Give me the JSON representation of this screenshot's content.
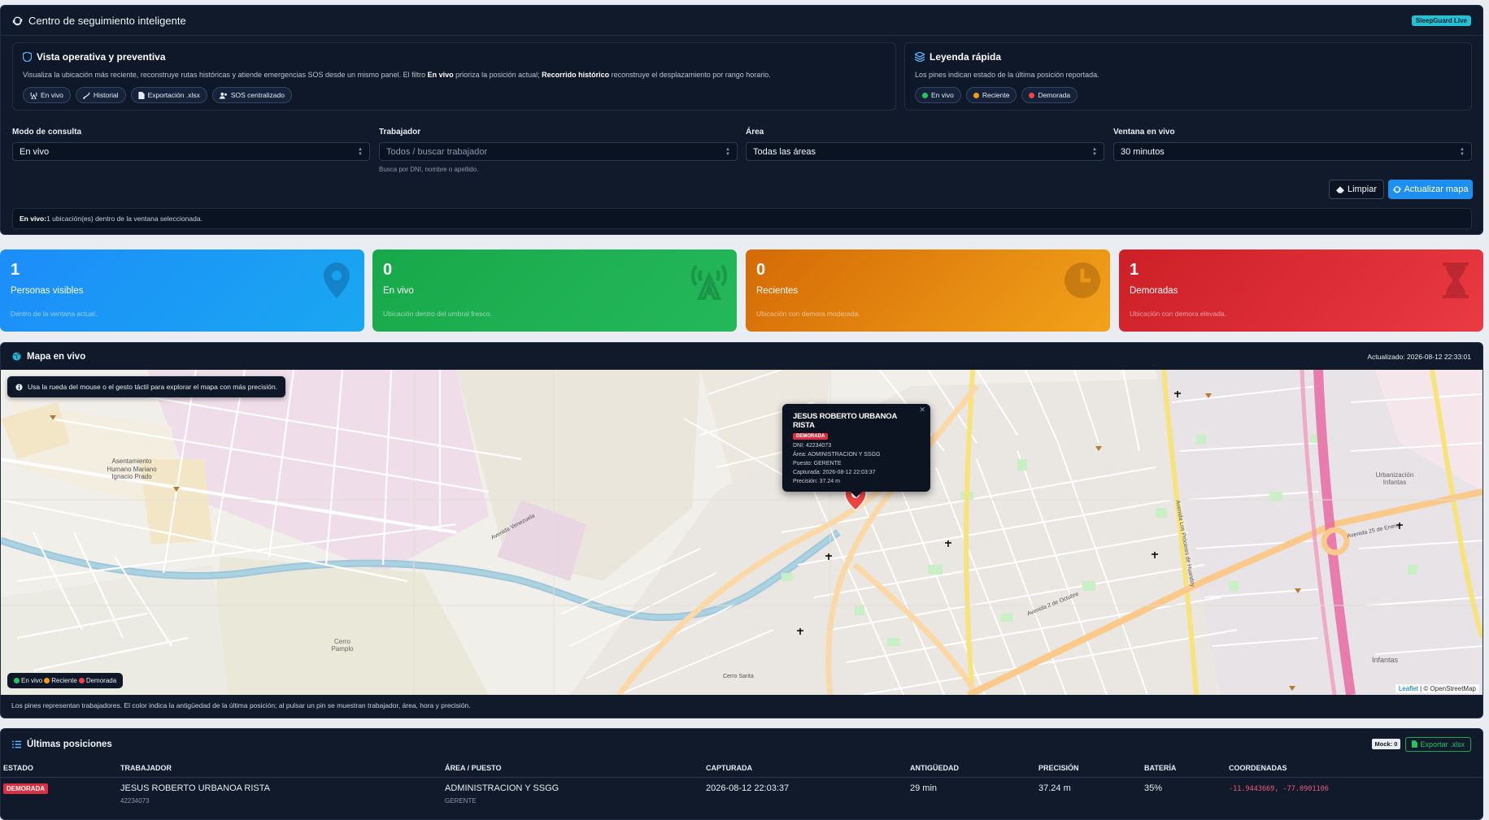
{
  "header": {
    "title": "Centro de seguimiento inteligente",
    "badge": "SleepGuard Live"
  },
  "overview": {
    "title": "Vista operativa y preventiva",
    "desc_a": "Visualiza la ubicación más reciente, reconstruye rutas históricas y atiende emergencias SOS desde un mismo panel. El filtro ",
    "desc_b": "En vivo",
    "desc_c": " prioriza la posición actual; ",
    "desc_d": "Recorrido histórico",
    "desc_e": " reconstruye el desplazamiento por rango horario.",
    "chips": [
      "En vivo",
      "Historial",
      "Exportación .xlsx",
      "SOS centralizado"
    ]
  },
  "legend": {
    "title": "Leyenda rápida",
    "desc": "Los pines indican estado de la última posición reportada.",
    "items": [
      {
        "label": "En vivo",
        "color": "#22c55e"
      },
      {
        "label": "Reciente",
        "color": "#f59e0b"
      },
      {
        "label": "Demorada",
        "color": "#ef4444"
      }
    ]
  },
  "filters": {
    "mode": {
      "label": "Modo de consulta",
      "value": "En vivo"
    },
    "worker": {
      "label": "Trabajador",
      "placeholder": "Todos / buscar trabajador",
      "hint": "Busca por DNI, nombre o apellido."
    },
    "area": {
      "label": "Área",
      "value": "Todas las áreas"
    },
    "window": {
      "label": "Ventana en vivo",
      "value": "30 minutos"
    }
  },
  "actions": {
    "clear": "Limpiar",
    "refresh": "Actualizar mapa"
  },
  "status": {
    "prefix": "En vivo:",
    "text": " 1 ubicación(es) dentro de la ventana seleccionada."
  },
  "kpis": [
    {
      "value": "1",
      "label": "Personas visibles",
      "sub": "Dentro de la ventana actual."
    },
    {
      "value": "0",
      "label": "En vivo",
      "sub": "Ubicación dentro del umbral fresco."
    },
    {
      "value": "0",
      "label": "Recientes",
      "sub": "Ubicación con demora moderada."
    },
    {
      "value": "1",
      "label": "Demoradas",
      "sub": "Ubicación con demora elevada."
    }
  ],
  "map": {
    "title": "Mapa en vivo",
    "updated": "Actualizado: 2026-08-12 22:33:01",
    "toast": "Usa la rueda del mouse o el gesto táctil para explorar el mapa con más precisión.",
    "legend": [
      "En vivo",
      "Reciente",
      "Demorada"
    ],
    "popup": {
      "name": "JESUS ROBERTO URBANOA RISTA",
      "tag": "DEMORADA",
      "lines": [
        "DNI: 42234073",
        "Área: ADMINISTRACION Y SSGG",
        "Puesto: GERENTE",
        "Capturada: 2026-08-12 22:03:37",
        "Precisión: 37.24 m"
      ]
    },
    "attrib_leaflet": "Leaflet",
    "attrib_osm": " | © OpenStreetMap",
    "labels": [
      "Asentamiento Humano Mariano Ignacio Prado",
      "Avenida Venezuela",
      "Avenida 2 de Octubre",
      "Avenida 25 de Enero",
      "Urbanización Infantas",
      "Infantas",
      "Cerro Pamplo",
      "Avenida Los Próceres de Huandoy",
      "Cerro Sarita"
    ],
    "footnote": "Los pines representan trabajadores. El color indica la antigüedad de la última posición; al pulsar un pin se muestran trabajador, área, hora y precisión."
  },
  "positions": {
    "title": "Últimas posiciones",
    "mock": "Mock: 0",
    "export": "Exportar .xlsx",
    "columns": [
      "ESTADO",
      "TRABAJADOR",
      "ÁREA / PUESTO",
      "CAPTURADA",
      "ANTIGÜEDAD",
      "PRECISIÓN",
      "BATERÍA",
      "COORDENADAS"
    ],
    "rows": [
      {
        "status": "DEMORADA",
        "worker": "JESUS ROBERTO URBANOA RISTA",
        "dni": "42234073",
        "area": "ADMINISTRACION Y SSGG",
        "role": "GERENTE",
        "captured": "2026-08-12 22:03:37",
        "age": "29 min",
        "precision": "37.24 m",
        "battery": "35%",
        "coords": "-11.9443669, -77.0901106"
      }
    ]
  }
}
